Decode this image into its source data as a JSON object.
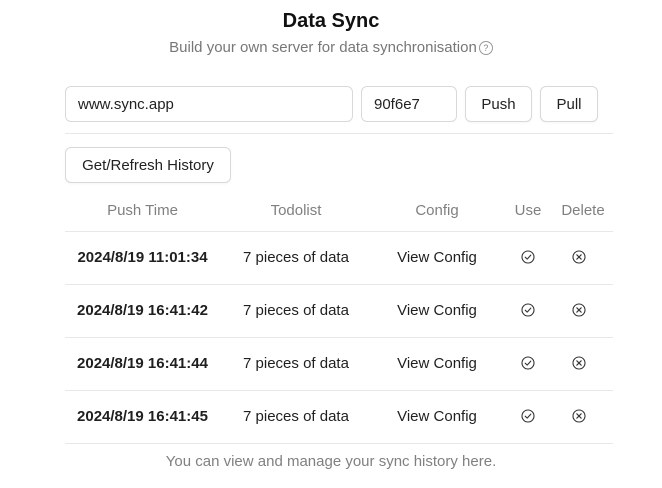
{
  "header": {
    "title": "Data Sync",
    "subtitle": "Build your own server for data synchronisation",
    "help_icon": "question-circle"
  },
  "sync_form": {
    "server_value": "www.sync.app",
    "token_value": "90f6e7",
    "push_label": "Push",
    "pull_label": "Pull"
  },
  "history": {
    "refresh_label": "Get/Refresh History",
    "columns": [
      "Push Time",
      "Todolist",
      "Config",
      "Use",
      "Delete"
    ],
    "rows": [
      {
        "time": "2024/8/19 11:01:34",
        "todolist": "7 pieces of data",
        "config": "View Config"
      },
      {
        "time": "2024/8/19 16:41:42",
        "todolist": "7 pieces of data",
        "config": "View Config"
      },
      {
        "time": "2024/8/19 16:41:44",
        "todolist": "7 pieces of data",
        "config": "View Config"
      },
      {
        "time": "2024/8/19 16:41:45",
        "todolist": "7 pieces of data",
        "config": "View Config"
      }
    ],
    "use_icon": "check-circle",
    "delete_icon": "close-circle"
  },
  "footer": {
    "text": "You can view and manage your sync history here."
  }
}
